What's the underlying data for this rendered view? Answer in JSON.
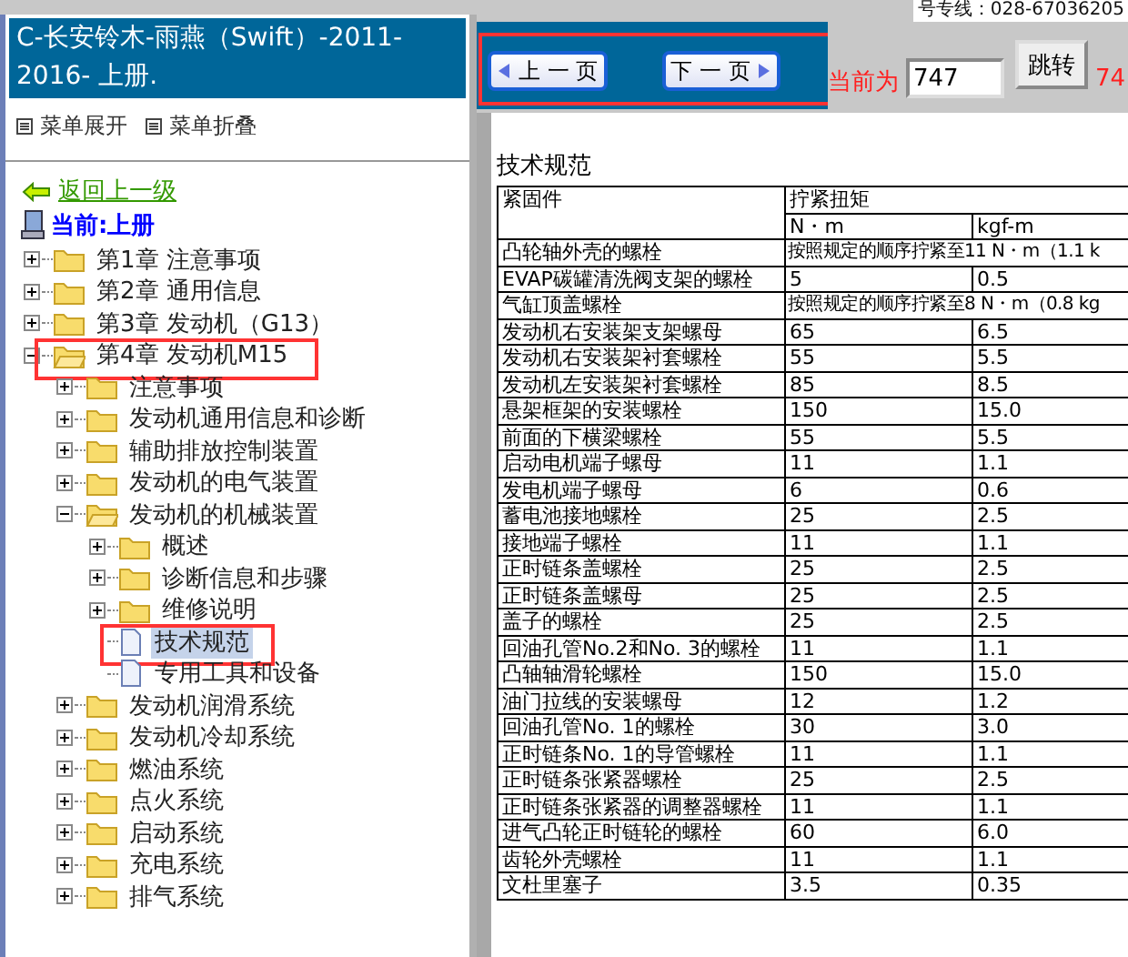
{
  "sidebar": {
    "title": "C-长安铃木-雨燕（Swift）-2011-2016- 上册.",
    "menu_actions": [
      "菜单展开",
      "菜单折叠"
    ],
    "back_link": "返回上一级",
    "current": "当前:上册",
    "tree": [
      {
        "label": "第1章 注意事项",
        "kind": "folder",
        "expanded": false,
        "selected": false,
        "highlighted": false
      },
      {
        "label": "第2章 通用信息",
        "kind": "folder",
        "expanded": false,
        "selected": false,
        "highlighted": false
      },
      {
        "label": "第3章 发动机（G13）",
        "kind": "folder",
        "expanded": false,
        "selected": false,
        "highlighted": false
      },
      {
        "label": "第4章 发动机M15",
        "kind": "folder",
        "expanded": true,
        "selected": false,
        "highlighted": true,
        "children": [
          {
            "label": "注意事项",
            "kind": "folder",
            "expanded": false,
            "selected": false,
            "highlighted": false
          },
          {
            "label": "发动机通用信息和诊断",
            "kind": "folder",
            "expanded": false,
            "selected": false,
            "highlighted": false
          },
          {
            "label": "辅助排放控制装置",
            "kind": "folder",
            "expanded": false,
            "selected": false,
            "highlighted": false
          },
          {
            "label": "发动机的电气装置",
            "kind": "folder",
            "expanded": false,
            "selected": false,
            "highlighted": false
          },
          {
            "label": "发动机的机械装置",
            "kind": "folder",
            "expanded": true,
            "selected": false,
            "highlighted": false,
            "children": [
              {
                "label": "概述",
                "kind": "folder",
                "expanded": false,
                "selected": false,
                "highlighted": false
              },
              {
                "label": "诊断信息和步骤",
                "kind": "folder",
                "expanded": false,
                "selected": false,
                "highlighted": false
              },
              {
                "label": "维修说明",
                "kind": "folder",
                "expanded": false,
                "selected": false,
                "highlighted": false
              },
              {
                "label": "技术规范",
                "kind": "document",
                "selected": true,
                "highlighted": true
              },
              {
                "label": "专用工具和设备",
                "kind": "document",
                "selected": false,
                "highlighted": false
              }
            ]
          },
          {
            "label": "发动机润滑系统",
            "kind": "folder",
            "expanded": false,
            "selected": false,
            "highlighted": false
          },
          {
            "label": "发动机冷却系统",
            "kind": "folder",
            "expanded": false,
            "selected": false,
            "highlighted": false
          },
          {
            "label": "燃油系统",
            "kind": "folder",
            "expanded": false,
            "selected": false,
            "highlighted": false
          },
          {
            "label": "点火系统",
            "kind": "folder",
            "expanded": false,
            "selected": false,
            "highlighted": false
          },
          {
            "label": "启动系统",
            "kind": "folder",
            "expanded": false,
            "selected": false,
            "highlighted": false
          },
          {
            "label": "充电系统",
            "kind": "folder",
            "expanded": false,
            "selected": false,
            "highlighted": false
          },
          {
            "label": "排气系统",
            "kind": "folder",
            "expanded": false,
            "selected": false,
            "highlighted": false
          }
        ]
      }
    ]
  },
  "top_strip_text": "号专线：028-67036205",
  "nav": {
    "highlighted": true,
    "prev": "上 一 页",
    "next": "下 一 页",
    "current_label": "当前为",
    "page_value": "747",
    "jump": "跳转",
    "total": "74"
  },
  "document": {
    "title": "技术规范",
    "header": {
      "fastener": "紧固件",
      "torque": "拧紧扭矩",
      "unit_1": "N・m",
      "unit_2": "kgf-m"
    },
    "rows": [
      {
        "kind": "span",
        "fastener": "凸轮轴外壳的螺栓",
        "note": "按照规定的顺序拧紧至11 N・m（1.1 k"
      },
      {
        "kind": "pair",
        "fastener": "EVAP碳罐清洗阀支架的螺栓",
        "nm": "5",
        "kgf": "0.5"
      },
      {
        "kind": "span",
        "fastener": "气缸顶盖螺栓",
        "note": "按照规定的顺序拧紧至8 N・m（0.8 kg"
      },
      {
        "kind": "pair",
        "fastener": "发动机右安装架支架螺母",
        "nm": "65",
        "kgf": "6.5"
      },
      {
        "kind": "pair",
        "fastener": "发动机右安装架衬套螺栓",
        "nm": "55",
        "kgf": "5.5"
      },
      {
        "kind": "pair",
        "fastener": "发动机左安装架衬套螺栓",
        "nm": "85",
        "kgf": "8.5"
      },
      {
        "kind": "pair",
        "fastener": "悬架框架的安装螺栓",
        "nm": "150",
        "kgf": "15.0"
      },
      {
        "kind": "pair",
        "fastener": "前面的下横梁螺栓",
        "nm": "55",
        "kgf": "5.5"
      },
      {
        "kind": "pair",
        "fastener": "启动电机端子螺母",
        "nm": "11",
        "kgf": "1.1"
      },
      {
        "kind": "pair",
        "fastener": "发电机端子螺母",
        "nm": "6",
        "kgf": "0.6"
      },
      {
        "kind": "pair",
        "fastener": "蓄电池接地螺栓",
        "nm": "25",
        "kgf": "2.5"
      },
      {
        "kind": "pair",
        "fastener": "接地端子螺栓",
        "nm": "11",
        "kgf": "1.1"
      },
      {
        "kind": "pair",
        "fastener": "正时链条盖螺栓",
        "nm": "25",
        "kgf": "2.5"
      },
      {
        "kind": "pair",
        "fastener": "正时链条盖螺母",
        "nm": "25",
        "kgf": "2.5"
      },
      {
        "kind": "pair",
        "fastener": "盖子的螺栓",
        "nm": "25",
        "kgf": "2.5"
      },
      {
        "kind": "pair",
        "fastener": "回油孔管No.2和No. 3的螺栓",
        "nm": "11",
        "kgf": "1.1"
      },
      {
        "kind": "pair",
        "fastener": "凸轴轴滑轮螺栓",
        "nm": "150",
        "kgf": "15.0"
      },
      {
        "kind": "pair",
        "fastener": "油门拉线的安装螺母",
        "nm": "12",
        "kgf": "1.2"
      },
      {
        "kind": "pair",
        "fastener": "回油孔管No. 1的螺栓",
        "nm": "30",
        "kgf": "3.0"
      },
      {
        "kind": "pair",
        "fastener": "正时链条No. 1的导管螺栓",
        "nm": "11",
        "kgf": "1.1"
      },
      {
        "kind": "pair",
        "fastener": "正时链条张紧器螺栓",
        "nm": "25",
        "kgf": "2.5"
      },
      {
        "kind": "pair",
        "fastener": "正时链条张紧器的调整器螺栓",
        "nm": "11",
        "kgf": "1.1"
      },
      {
        "kind": "pair",
        "fastener": "进气凸轮正时链轮的螺栓",
        "nm": "60",
        "kgf": "6.0"
      },
      {
        "kind": "pair",
        "fastener": "齿轮外壳螺栓",
        "nm": "11",
        "kgf": "1.1"
      },
      {
        "kind": "pair",
        "fastener": "文杜里塞子",
        "nm": "3.5",
        "kgf": "0.35"
      }
    ]
  }
}
